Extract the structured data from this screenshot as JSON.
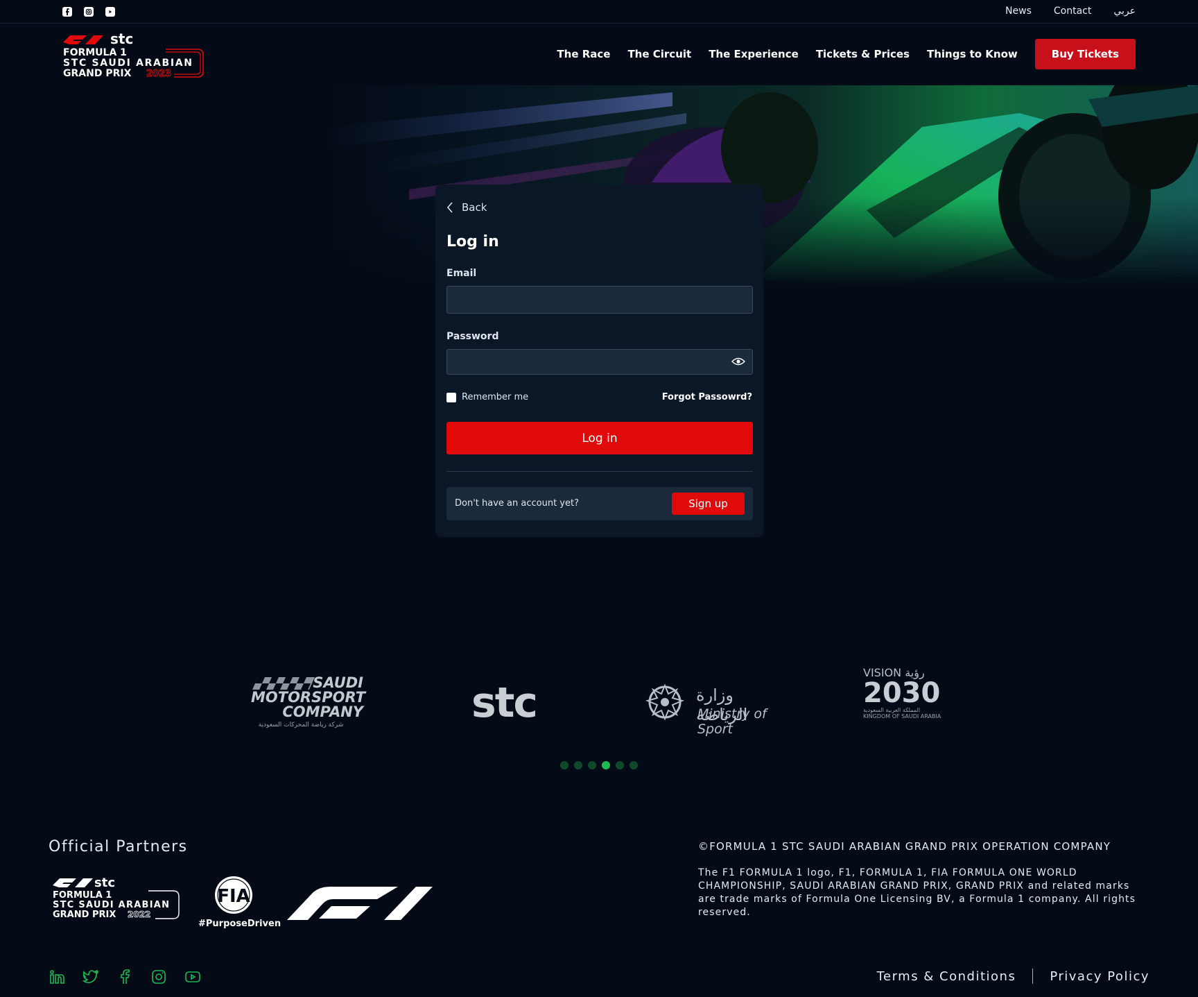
{
  "topbar": {
    "socials": [
      "facebook-icon",
      "instagram-icon",
      "youtube-icon"
    ],
    "links": {
      "news": "News",
      "contact": "Contact",
      "arabic": "عربي"
    }
  },
  "header": {
    "logo": {
      "line1": "stc",
      "line2": "FORMULA 1",
      "line3": "STC SAUDI ARABIAN",
      "line4": "GRAND PRIX",
      "year": "2023"
    },
    "nav": [
      "The Race",
      "The Circuit",
      "The Experience",
      "Tickets & Prices",
      "Things to Know"
    ],
    "buy_tickets": "Buy Tickets"
  },
  "login": {
    "back": "Back",
    "title": "Log in",
    "email_label": "Email",
    "email_value": "",
    "password_label": "Password",
    "password_value": "",
    "remember": "Remember me",
    "forgot": "Forgot Passowrd?",
    "submit": "Log in",
    "no_account": "Don't have an account yet?",
    "signup": "Sign up"
  },
  "sponsors": {
    "smc": {
      "l1": "SAUDI",
      "l2": "MOTORSPORT",
      "l3": "COMPANY",
      "ar": "شركة رياضة المحركات السعودية"
    },
    "stc": "stc",
    "ministry": {
      "ar": "وزارة الرياضة",
      "en": "Ministry of Sport"
    },
    "vision": {
      "v1": "VISION رؤية",
      "v2": "2030",
      "v3": "المملكة العربية السعودية",
      "v4": "KINGDOM OF SAUDI ARABIA"
    },
    "dots": [
      false,
      false,
      false,
      true,
      false,
      false
    ]
  },
  "footer": {
    "partners_title": "Official Partners",
    "partner_logos": {
      "gp": {
        "line1": "stc",
        "line2": "FORMULA 1",
        "line3": "STC SAUDI ARABIAN",
        "line4": "GRAND PRIX",
        "year": "2022"
      },
      "fia": "FIA",
      "fia_tag": "#PurposeDriven"
    },
    "copyright": "©FORMULA 1 STC SAUDI ARABIAN GRAND PRIX OPERATION COMPANY",
    "legal": "The F1 FORMULA 1 logo, F1, FORMULA 1, FIA FORMULA ONE WORLD CHAMPIONSHIP, SAUDI ARABIAN GRAND PRIX, GRAND PRIX and related marks are trade marks of Formula One Licensing BV, a Formula 1 company. All rights reserved.",
    "socials": [
      "linkedin-icon",
      "twitter-icon",
      "facebook-icon",
      "instagram-icon",
      "youtube-icon"
    ],
    "terms": "Terms & Conditions",
    "privacy": "Privacy Policy"
  },
  "colors": {
    "background": "#040b16",
    "accent_red": "#e10a0a",
    "buy_red": "#c8101a",
    "green": "#1db954"
  }
}
